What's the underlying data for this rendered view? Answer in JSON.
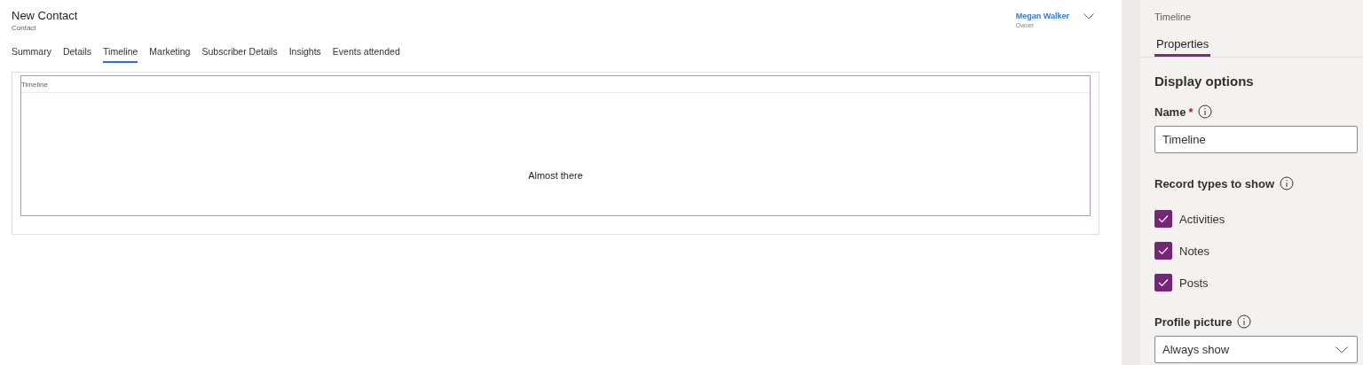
{
  "form": {
    "title": "New Contact",
    "entity": "Contact",
    "owner": {
      "name": "Megan Walker",
      "label": "Owner"
    },
    "tabs": [
      {
        "label": "Summary",
        "selected": false
      },
      {
        "label": "Details",
        "selected": false
      },
      {
        "label": "Timeline",
        "selected": true
      },
      {
        "label": "Marketing",
        "selected": false
      },
      {
        "label": "Subscriber Details",
        "selected": false
      },
      {
        "label": "Insights",
        "selected": false
      },
      {
        "label": "Events attended",
        "selected": false
      }
    ],
    "section": {
      "label": "Timeline",
      "message": "Almost there"
    }
  },
  "panel": {
    "title": "Timeline",
    "tabs": [
      {
        "label": "Properties",
        "selected": true
      }
    ],
    "heading": "Display options",
    "name_field": {
      "label": "Name",
      "required_mark": "*",
      "value": "Timeline"
    },
    "record_types": {
      "label": "Record types to show",
      "items": [
        {
          "label": "Activities",
          "checked": true
        },
        {
          "label": "Notes",
          "checked": true
        },
        {
          "label": "Posts",
          "checked": true
        }
      ]
    },
    "profile_picture": {
      "label": "Profile picture",
      "value": "Always show"
    }
  }
}
